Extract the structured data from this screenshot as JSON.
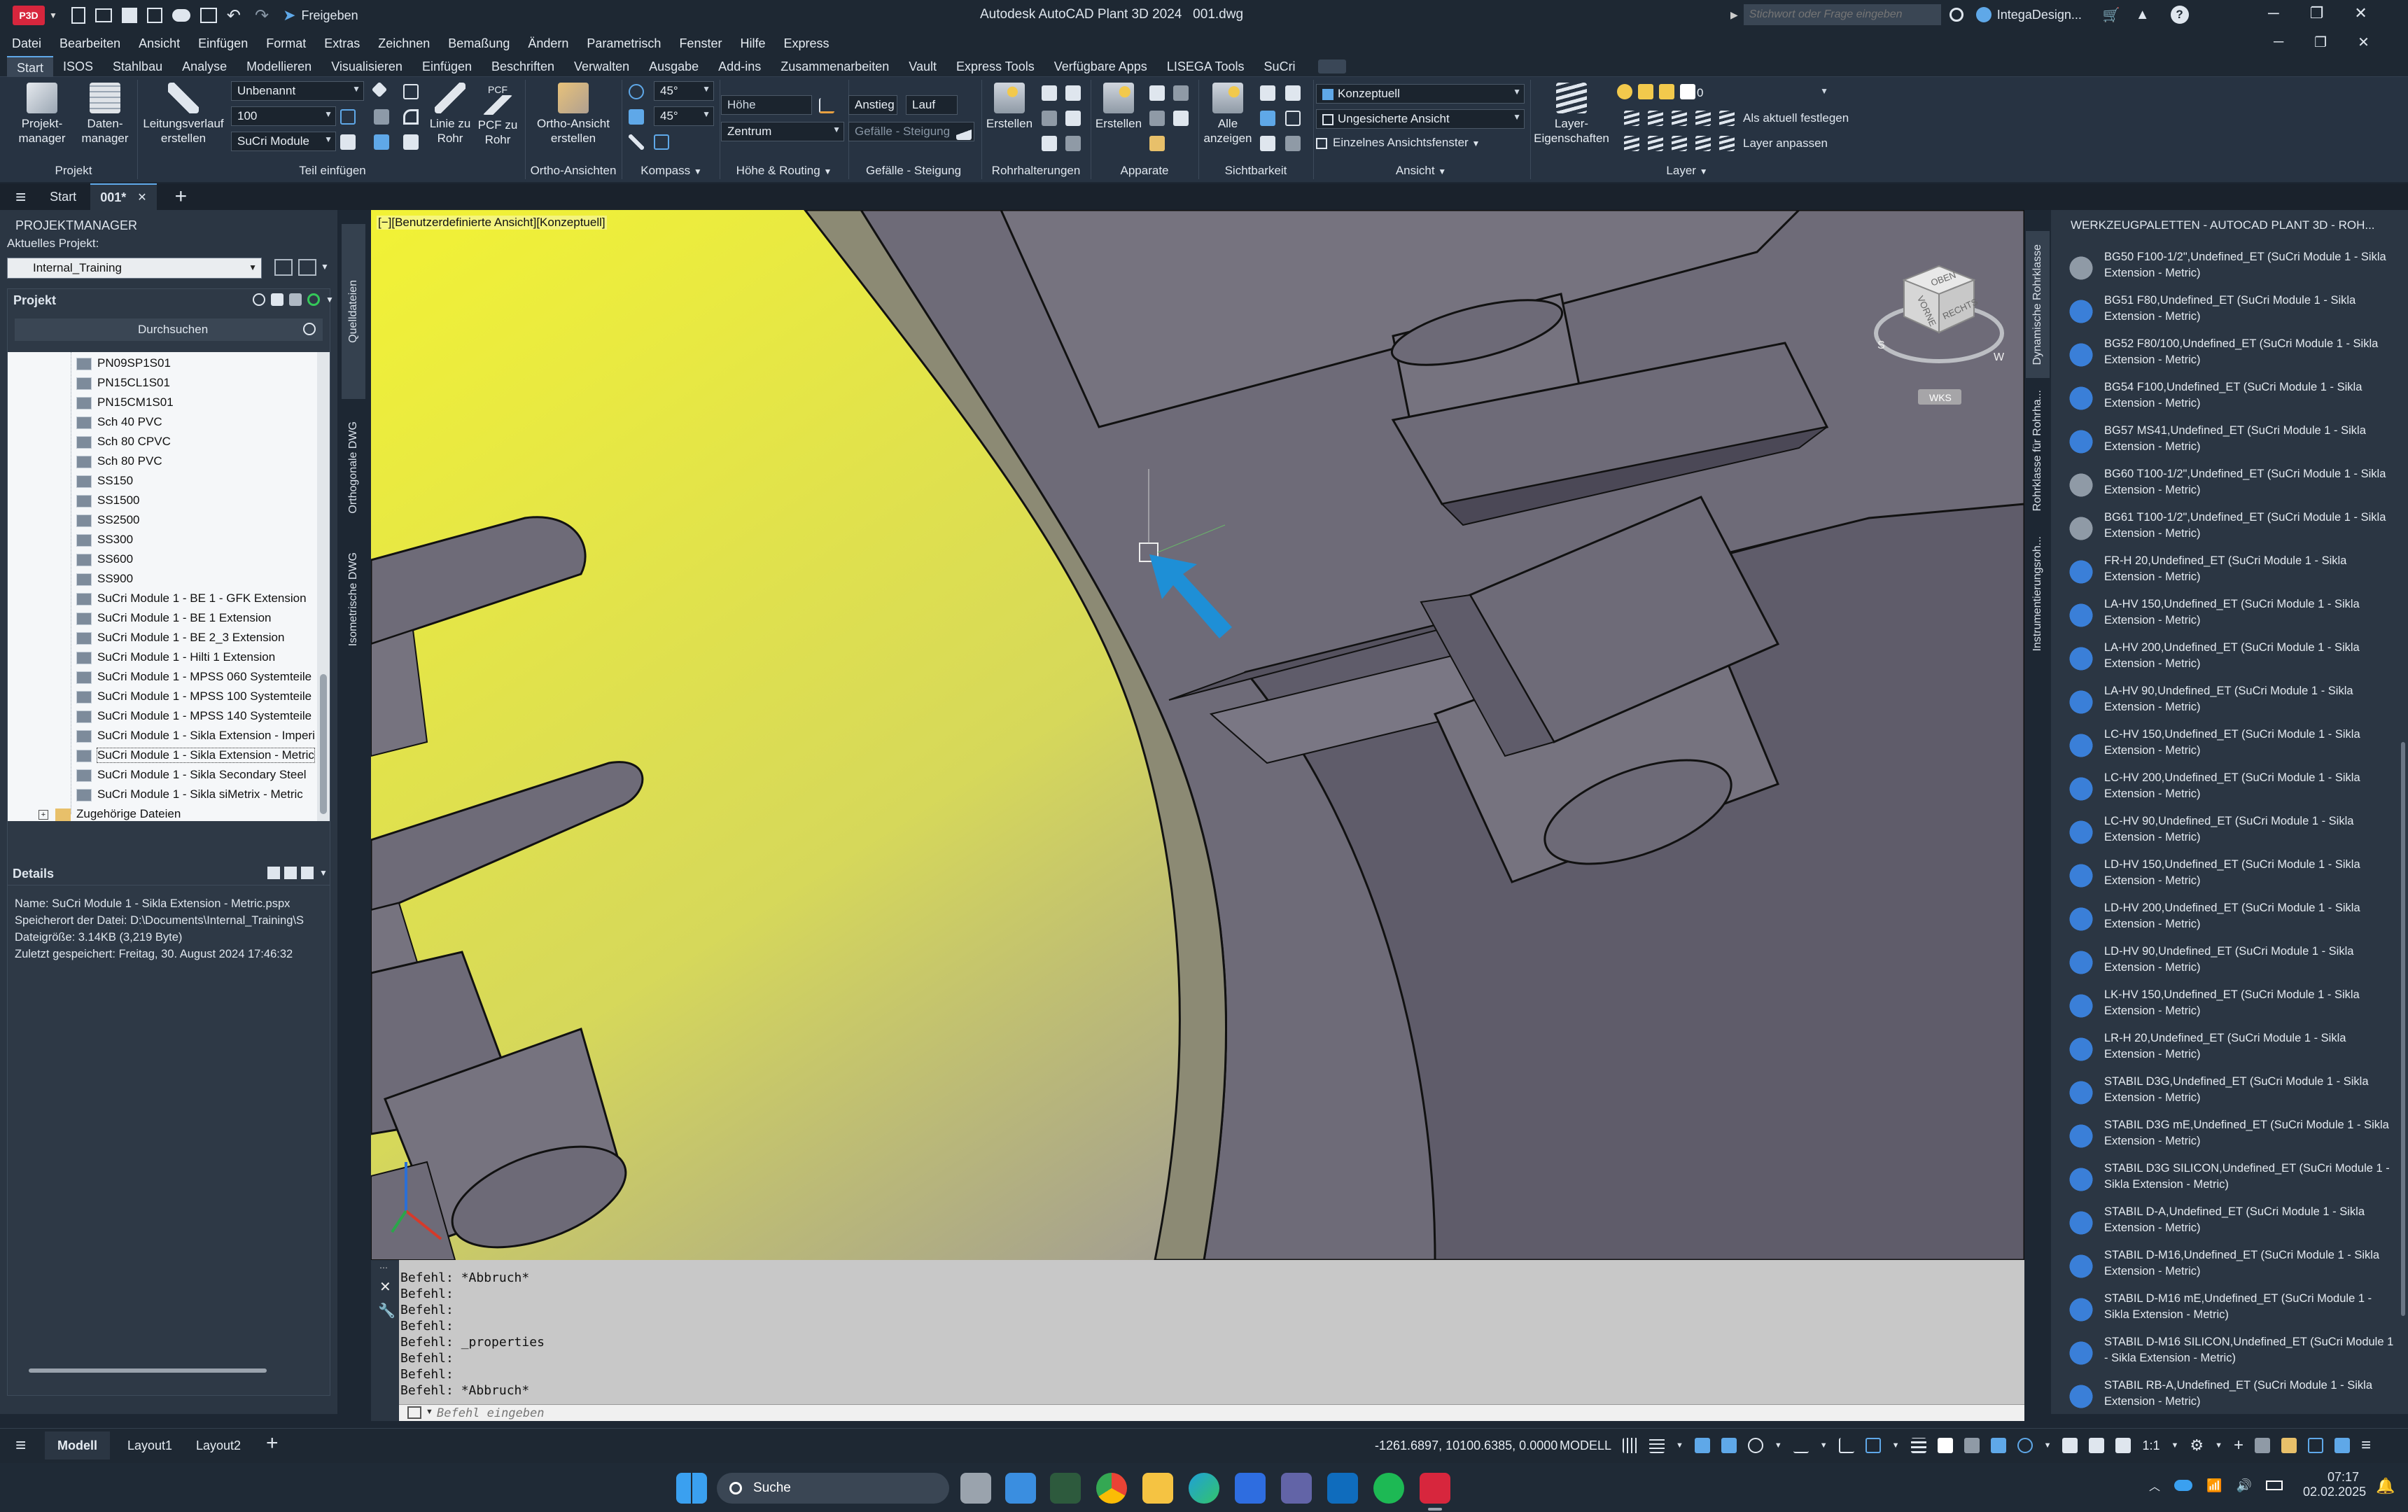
{
  "app": {
    "badge": "P3D",
    "share_label": "Freigeben",
    "title": "Autodesk AutoCAD Plant 3D 2024   001.dwg",
    "search_placeholder": "Stichwort oder Frage eingeben",
    "user": "IntegaDesign..."
  },
  "menu": [
    "Datei",
    "Bearbeiten",
    "Ansicht",
    "Einfügen",
    "Format",
    "Extras",
    "Zeichnen",
    "Bemaßung",
    "Ändern",
    "Parametrisch",
    "Fenster",
    "Hilfe",
    "Express"
  ],
  "ribbon_tabs": [
    "Start",
    "ISOS",
    "Stahlbau",
    "Analyse",
    "Modellieren",
    "Visualisieren",
    "Einfügen",
    "Beschriften",
    "Verwalten",
    "Ausgabe",
    "Add-ins",
    "Zusammenarbeiten",
    "Vault",
    "Express Tools",
    "Verfügbare Apps",
    "LISEGA Tools",
    "SuCri"
  ],
  "ribbon": {
    "projekt": {
      "btn1": "Projekt-\nmanager",
      "btn2": "Daten-\nmanager",
      "label": "Projekt"
    },
    "teil": {
      "btn1": "Leitungsverlauf\nerstellen",
      "field1": "Unbenannt",
      "field2": "100",
      "field3": "SuCri Module",
      "btn2": "Linie zu\nRohr",
      "btn3": "PCF zu\nRohr",
      "btn3_top": "PCF",
      "label": "Teil einfügen"
    },
    "ortho": {
      "btn": "Ortho-Ansicht\nerstellen",
      "label": "Ortho-Ansichten"
    },
    "kompass": {
      "f1": "45°",
      "f2": "45°",
      "label": "Kompass"
    },
    "hoehe": {
      "f1": "Höhe",
      "f2": "Zentrum",
      "label": "Höhe & Routing"
    },
    "gefaelle": {
      "f1": "Anstieg",
      "f2": "Lauf",
      "f3": "Gefälle - Steigung",
      "label": "Gefälle - Steigung"
    },
    "rohr": {
      "btn": "Erstellen",
      "label": "Rohrhalterungen"
    },
    "apparate": {
      "btn": "Erstellen",
      "label": "Apparate"
    },
    "sicht": {
      "btn": "Alle\nanzeigen",
      "label": "Sichtbarkeit"
    },
    "ansicht": {
      "f1": "Konzeptuell",
      "f2": "Ungesicherte Ansicht",
      "f3": "Einzelnes Ansichtsfenster",
      "label": "Ansicht"
    },
    "layer": {
      "btn": "Layer-\nEigenschaften",
      "f1": "0",
      "b1": "Als aktuell festlegen",
      "b2": "Layer anpassen",
      "label": "Layer"
    }
  },
  "doc_tabs": [
    "Start",
    "001*"
  ],
  "projektmanager": {
    "title": "PROJEKTMANAGER",
    "current_label": "Aktuelles Projekt:",
    "current_value": "Internal_Training",
    "projekt_label": "Projekt",
    "search_label": "Durchsuchen",
    "tree": [
      "PN09SP1S01",
      "PN15CL1S01",
      "PN15CM1S01",
      "Sch 40 PVC",
      "Sch 80 CPVC",
      "Sch 80 PVC",
      "SS150",
      "SS1500",
      "SS2500",
      "SS300",
      "SS600",
      "SS900",
      "SuCri Module 1 - BE 1 - GFK Extension",
      "SuCri Module 1 - BE 1 Extension",
      "SuCri Module 1 - BE 2_3 Extension",
      "SuCri Module 1 - Hilti 1 Extension",
      "SuCri Module 1 - MPSS 060 Systemteile",
      "SuCri Module 1 - MPSS 100 Systemteile",
      "SuCri Module 1 - MPSS 140 Systemteile",
      "SuCri Module 1 - Sikla Extension - Imperi",
      "SuCri Module 1 - Sikla Extension - Metric",
      "SuCri Module 1 - Sikla Secondary Steel",
      "SuCri Module 1 - Sikla siMetrix - Metric"
    ],
    "tree_last": "Zugehörige Dateien",
    "details_title": "Details",
    "details": [
      "Name: SuCri Module 1 - Sikla Extension - Metric.pspx",
      "Speicherort der Datei: D:\\Documents\\Internal_Training\\S",
      "Dateigröße: 3.14KB (3,219 Byte)",
      "Zuletzt gespeichert: Freitag, 30. August 2024 17:46:32"
    ]
  },
  "left_vtabs": [
    "Quelldateien",
    "Orthogonale DWG",
    "Isometrische DWG"
  ],
  "viewport": {
    "label": "[−][Benutzerdefinierte Ansicht][Konzeptuell]",
    "cube_top": "OBEN",
    "cube_front": "VORNE",
    "cube_right": "RECHTS",
    "cube_s": "S",
    "cube_w": "W",
    "wks": "WKS"
  },
  "command": {
    "lines": [
      "Befehl: *Abbruch*",
      "Befehl:",
      "Befehl:",
      "Befehl:",
      "Befehl: _properties",
      "Befehl:",
      "Befehl:",
      "Befehl: *Abbruch*"
    ],
    "placeholder": "Befehl eingeben"
  },
  "palette": {
    "title": "WERKZEUGPALETTEN - AUTOCAD PLANT 3D - ROH...",
    "vtabs": [
      "Dynamische Rohrklasse",
      "Rohrklasse für Rohrha...",
      "Instrumentierungsroh..."
    ],
    "items": [
      "BG50 F100-1/2\",Undefined_ET (SuCri Module 1 - Sikla Extension - Metric)",
      "BG51 F80,Undefined_ET (SuCri Module 1 - Sikla Extension - Metric)",
      "BG52 F80/100,Undefined_ET (SuCri Module 1 - Sikla Extension - Metric)",
      "BG54 F100,Undefined_ET (SuCri Module 1 - Sikla Extension - Metric)",
      "BG57 MS41,Undefined_ET (SuCri Module 1 - Sikla Extension - Metric)",
      "BG60 T100-1/2\",Undefined_ET (SuCri Module 1 - Sikla Extension - Metric)",
      "BG61 T100-1/2\",Undefined_ET (SuCri Module 1 - Sikla Extension - Metric)",
      "FR-H 20,Undefined_ET (SuCri Module 1 - Sikla Extension - Metric)",
      "LA-HV 150,Undefined_ET (SuCri Module 1 - Sikla Extension - Metric)",
      "LA-HV 200,Undefined_ET (SuCri Module 1 - Sikla Extension - Metric)",
      "LA-HV 90,Undefined_ET (SuCri Module 1 - Sikla Extension - Metric)",
      "LC-HV 150,Undefined_ET (SuCri Module 1 - Sikla Extension - Metric)",
      "LC-HV 200,Undefined_ET (SuCri Module 1 - Sikla Extension - Metric)",
      "LC-HV 90,Undefined_ET (SuCri Module 1 - Sikla Extension - Metric)",
      "LD-HV 150,Undefined_ET (SuCri Module 1 - Sikla Extension - Metric)",
      "LD-HV 200,Undefined_ET (SuCri Module 1 - Sikla Extension - Metric)",
      "LD-HV 90,Undefined_ET (SuCri Module 1 - Sikla Extension - Metric)",
      "LK-HV 150,Undefined_ET (SuCri Module 1 - Sikla Extension - Metric)",
      "LR-H 20,Undefined_ET (SuCri Module 1 - Sikla Extension - Metric)",
      "STABIL D3G,Undefined_ET (SuCri Module 1 - Sikla Extension - Metric)",
      "STABIL D3G mE,Undefined_ET (SuCri Module 1 - Sikla Extension - Metric)",
      "STABIL D3G SILICON,Undefined_ET (SuCri Module 1 - Sikla Extension - Metric)",
      "STABIL D-A,Undefined_ET (SuCri Module 1 - Sikla Extension - Metric)",
      "STABIL D-M16,Undefined_ET (SuCri Module 1 - Sikla Extension - Metric)",
      "STABIL D-M16 mE,Undefined_ET (SuCri Module 1 - Sikla Extension - Metric)",
      "STABIL D-M16 SILICON,Undefined_ET (SuCri Module 1 - Sikla Extension - Metric)",
      "STABIL RB-A,Undefined_ET (SuCri Module 1 - Sikla Extension - Metric)"
    ]
  },
  "status": {
    "tabs": [
      "Modell",
      "Layout1",
      "Layout2"
    ],
    "coords": "-1261.6897, 10100.6385, 0.0000",
    "mode": "MODELL",
    "scale": "1:1"
  },
  "taskbar": {
    "search": "Suche",
    "time": "07:17",
    "date": "02.02.2025"
  },
  "colors": {
    "accent": "#5fa8e8",
    "brand": "#d7263d",
    "viewport_yellow": "#e6ea42",
    "viewport_purple": "#5d58a8",
    "geometry": "#6e6b78"
  }
}
